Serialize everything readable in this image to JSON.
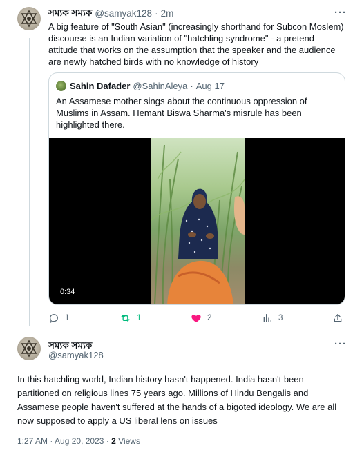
{
  "tweet1": {
    "author_name": "সম্যক সম্যক",
    "handle": "@samyak128",
    "separator": "·",
    "time": "2m",
    "more": "···",
    "text": "A big feature of \"South Asian\" (increasingly shorthand for Subcon Moslem) discourse is an Indian variation of \"hatchling syndrome\" - a pretend attitude that works on the assumption that the speaker and the audience are newly hatched birds with no knowledge of history",
    "quote": {
      "author_name": "Sahin Dafader",
      "handle": "@SahinAleya",
      "separator": "·",
      "date": "Aug 17",
      "text": "An Assamese mother sings about the continuous oppression of Muslims in Assam. Hemant Biswa Sharma's misrule has been highlighted there.",
      "video_duration": "0:34"
    },
    "actions": {
      "replies": "1",
      "retweets": "1",
      "likes": "2",
      "views": "3"
    },
    "colors": {
      "retweet_active": "#00ba7c",
      "like_active": "#f91880"
    }
  },
  "tweet2": {
    "author_name": "সম্যক সম্যক",
    "handle": "@samyak128",
    "text": "In this hatchling world, Indian history hasn't happened. India hasn't been partitioned on religious lines 75 years ago. Millions of Hindu Bengalis and Assamese people haven't suffered at the hands of a bigoted ideology. We are all now supposed to apply a US liberal lens on issues",
    "time": "1:27 AM",
    "separator": "·",
    "date": "Aug 20, 2023",
    "separator2": "·",
    "views_count": "2",
    "views_label": "Views"
  },
  "icons": {
    "reply": "reply-icon",
    "retweet": "retweet-icon",
    "like": "heart-icon",
    "views": "views-chart-icon",
    "share": "share-icon",
    "more": "more-horizontal-icon"
  }
}
